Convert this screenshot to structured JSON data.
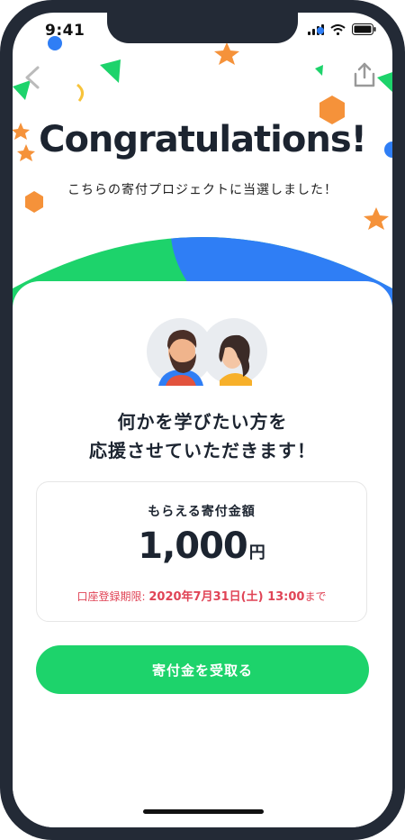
{
  "status_bar": {
    "time": "9:41"
  },
  "header": {
    "title": "Congratulations!",
    "subtitle": "こちらの寄付プロジェクトに当選しました！"
  },
  "card": {
    "message_line1": "何かを学びたい方を",
    "message_line2": "応援させていただきます！",
    "amount_label": "もらえる寄付金額",
    "amount_value": "1,000",
    "amount_unit": "円",
    "deadline_prefix": "口座登録期限: ",
    "deadline_date": "2020年7月31日(土) 13:00",
    "deadline_suffix": "まで",
    "cta_label": "寄付金を受取る"
  },
  "colors": {
    "green": "#1dd36b",
    "blue": "#2f7ef5",
    "orange": "#f5923a",
    "deadline_red": "#e04456",
    "frame": "#232a36"
  },
  "icons": [
    "back-chevron-icon",
    "share-icon",
    "signal-icon",
    "wifi-icon",
    "battery-icon"
  ]
}
